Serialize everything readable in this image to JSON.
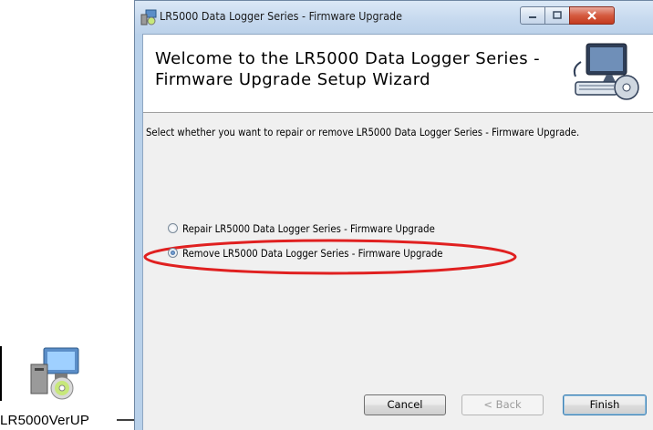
{
  "desktop_icon": {
    "label": "LR5000VerUP",
    "icon": "installer-package-icon",
    "arrow": "right-arrow"
  },
  "window": {
    "title": "LR5000 Data Logger Series - Firmware Upgrade",
    "title_icon": "installer-icon",
    "controls": [
      "minimize",
      "maximize",
      "close"
    ],
    "banner": {
      "heading": "Welcome to the LR5000 Data Logger Series - Firmware Upgrade Setup Wizard",
      "art": "computer-with-disc-icon"
    },
    "instruction": "Select whether you want to repair or remove LR5000 Data Logger Series - Firmware Upgrade.",
    "options": [
      {
        "label": "Repair LR5000 Data Logger Series - Firmware Upgrade",
        "selected": false
      },
      {
        "label": "Remove LR5000 Data Logger Series - Firmware Upgrade",
        "selected": true
      }
    ],
    "highlight_color": "#e02020",
    "buttons": {
      "cancel": "Cancel",
      "back": "< Back",
      "finish": "Finish"
    }
  }
}
